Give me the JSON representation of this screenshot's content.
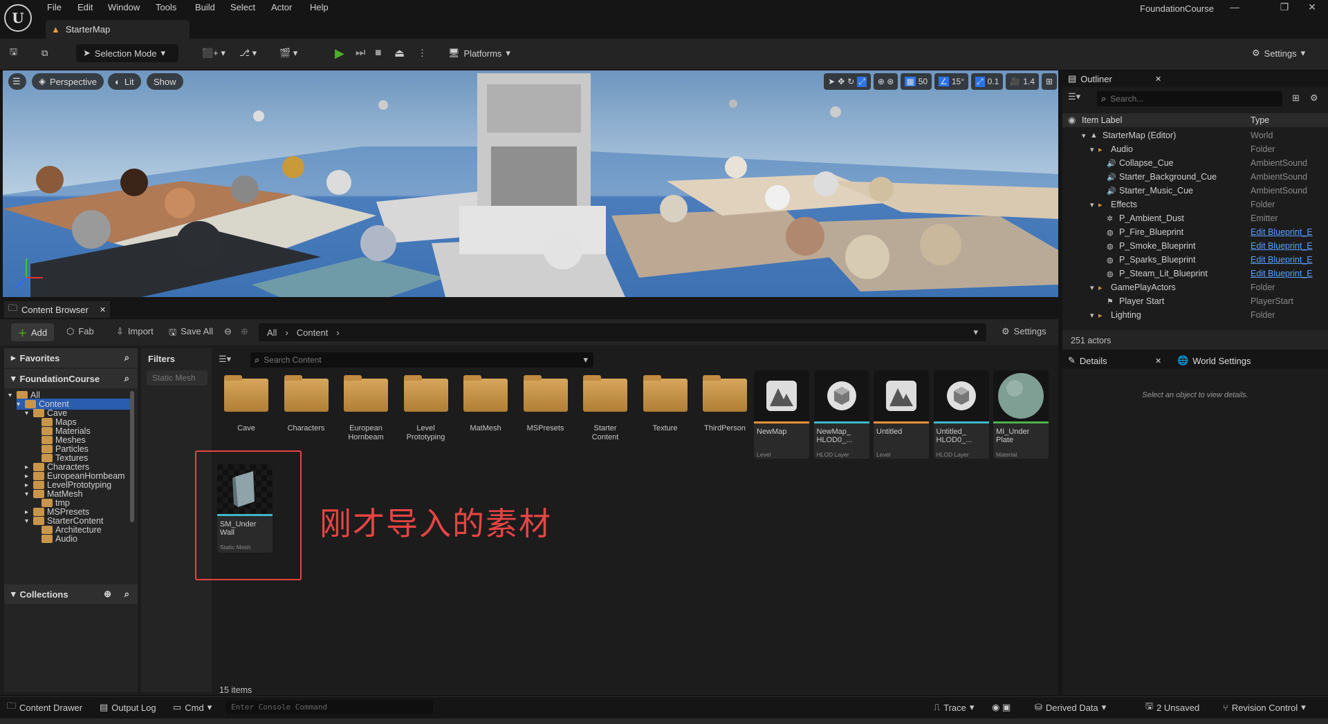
{
  "app": {
    "project_name": "FoundationCourse",
    "map_tab": "StarterMap"
  },
  "menu": [
    "File",
    "Edit",
    "Window",
    "Tools",
    "Build",
    "Select",
    "Actor",
    "Help"
  ],
  "toolbar": {
    "selection_mode": "Selection Mode",
    "platforms": "Platforms",
    "settings": "Settings"
  },
  "viewport": {
    "perspective": "Perspective",
    "lit": "Lit",
    "show": "Show",
    "grid_snap": "50",
    "rotation_snap": "15°",
    "scale_snap": "0.1",
    "camera_speed": "1.4"
  },
  "outliner": {
    "tab": "Outliner",
    "search_placeholder": "Search...",
    "col_label": "Item Label",
    "col_type": "Type",
    "rows": [
      {
        "label": "StarterMap (Editor)",
        "type": "World"
      },
      {
        "label": "Audio",
        "type": "Folder"
      },
      {
        "label": "Collapse_Cue",
        "type": "AmbientSound"
      },
      {
        "label": "Starter_Background_Cue",
        "type": "AmbientSound"
      },
      {
        "label": "Starter_Music_Cue",
        "type": "AmbientSound"
      },
      {
        "label": "Effects",
        "type": "Folder"
      },
      {
        "label": "P_Ambient_Dust",
        "type": "Emitter"
      },
      {
        "label": "P_Fire_Blueprint",
        "type": "Edit Blueprint_E"
      },
      {
        "label": "P_Smoke_Blueprint",
        "type": "Edit Blueprint_E"
      },
      {
        "label": "P_Sparks_Blueprint",
        "type": "Edit Blueprint_E"
      },
      {
        "label": "P_Steam_Lit_Blueprint",
        "type": "Edit Blueprint_E"
      },
      {
        "label": "GamePlayActors",
        "type": "Folder"
      },
      {
        "label": "Player Start",
        "type": "PlayerStart"
      },
      {
        "label": "Lighting",
        "type": "Folder"
      }
    ],
    "actor_count": "251 actors"
  },
  "details": {
    "tab": "Details",
    "world_settings_tab": "World Settings",
    "empty_message": "Select an object to view details."
  },
  "content_browser": {
    "tab": "Content Browser",
    "add": "Add",
    "fab": "Fab",
    "import": "Import",
    "save_all": "Save All",
    "path_all": "All",
    "path_content": "Content",
    "settings": "Settings",
    "favorites": "Favorites",
    "project": "FoundationCourse",
    "collections": "Collections",
    "filters": "Filters",
    "filter_chip": "Static Mesh",
    "search_placeholder": "Search Content",
    "tree": [
      "All",
      "Content",
      "Cave",
      "Maps",
      "Materials",
      "Meshes",
      "Particles",
      "Textures",
      "Characters",
      "EuropeanHornbeam",
      "LevelPrototyping",
      "MatMesh",
      "tmp",
      "MSPresets",
      "StarterContent",
      "Architecture",
      "Audio"
    ],
    "folders": [
      [
        "Cave"
      ],
      [
        "Characters"
      ],
      [
        "European",
        "Hornbeam"
      ],
      [
        "Level",
        "Prototyping"
      ],
      [
        "MatMesh"
      ],
      [
        "MSPresets"
      ],
      [
        "Starter",
        "Content"
      ],
      [
        "Texture"
      ],
      [
        "ThirdPerson"
      ]
    ],
    "assets": [
      {
        "name": [
          "NewMap"
        ],
        "type": "Level",
        "color": "#e8913a"
      },
      {
        "name": [
          "NewMap_",
          "HLOD0_..."
        ],
        "type": "HLOD Layer",
        "color": "#3fb8c8"
      },
      {
        "name": [
          "Untitled"
        ],
        "type": "Level",
        "color": "#e8913a"
      },
      {
        "name": [
          "Untitled_",
          "HLOD0_..."
        ],
        "type": "HLOD Layer",
        "color": "#3fb8c8"
      },
      {
        "name": [
          "MI_Under",
          "Plate"
        ],
        "type": "Material",
        "color": "#4fb24f"
      }
    ],
    "imported_asset": {
      "name": [
        "SM_Under",
        "Wall"
      ],
      "type": "Static Mesh",
      "color": "#3fb8c8"
    },
    "annotation": "刚才导入的素材",
    "item_count": "15 items"
  },
  "statusbar": {
    "content_drawer": "Content Drawer",
    "output_log": "Output Log",
    "cmd": "Cmd",
    "console_placeholder": "Enter Console Command",
    "trace": "Trace",
    "derived_data": "Derived Data",
    "unsaved": "2 Unsaved",
    "revision_control": "Revision Control"
  },
  "colors": {
    "accent": "#2a73e8",
    "annotation": "#e84444",
    "play": "#4caf2a"
  }
}
